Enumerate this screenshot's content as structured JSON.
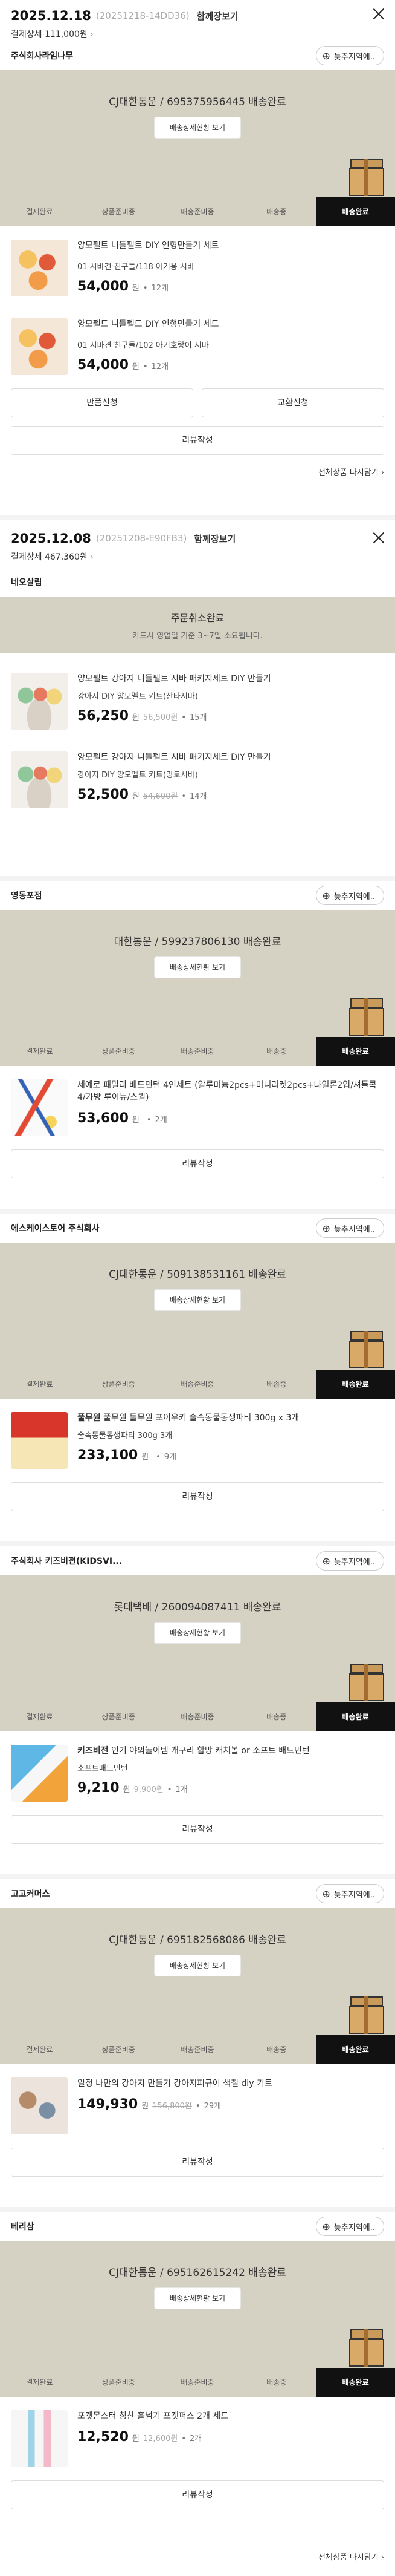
{
  "orders": [
    {
      "date": "2025.12.18",
      "order_no": "(20251218-14DD36)",
      "gift_label": "함께장보기",
      "pay_label": "결제상세",
      "pay_amount": "111,000원",
      "seller": "주식회사라임나무",
      "shipment": "CJ대한통운 / 695375956445 배송완료",
      "items": [
        {
          "name": "양모펠트 니들펠트 DIY 인형만들기 세트",
          "option": "01 시바견 친구들/118 아기용 시바",
          "price": "54,000",
          "qty": "12개"
        },
        {
          "name": "양모펠트 니들펠트 DIY 인형만들기 세트",
          "option": "01 시바견 친구들/102 아기호랑이 시바",
          "price": "54,000",
          "qty": "12개"
        }
      ],
      "return_label": "반품신청",
      "exchange_label": "교환신청",
      "review_label": "리뷰작성",
      "all_label": "전체상품 다시담기"
    },
    {
      "date": "2025.12.08",
      "order_no": "(20251208-E90FB3)",
      "gift_label": "함께장보기",
      "pay_label": "결제상세",
      "pay_amount": "467,360원",
      "seller": "네오살림",
      "cancel_title": "주문취소완료",
      "cancel_sub": "카드사 영업일 기준 3~7일 소요됩니다.",
      "items": [
        {
          "name": "양모펠트 강아지 니들펠트 시바 패키지세트 DIY 만들기",
          "option": "강아지 DIY 양모펠트 키트(산타시바)",
          "price": "56,250",
          "orig": "56,500원",
          "qty": "15개"
        },
        {
          "name": "양모펠트 강아지 니들펠트 시바 패키지세트 DIY 만들기",
          "option": "강아지 DIY 양모펠트 키트(망토시바)",
          "price": "52,500",
          "orig": "54,600원",
          "qty": "14개"
        }
      ]
    }
  ],
  "shipments": [
    {
      "seller": "영동포점",
      "status": "대한통운 / 599237806130 배송완료",
      "item_name": "세예로 패밀리 배드민턴 4인세트 (알루미늄2pcs+미니라켓2pcs+나일론2입/셔틀콕4/가방 루이뉴/스퀼)",
      "option": "",
      "price": "53,600",
      "orig": "",
      "qty": "2개",
      "seller_bold": ""
    },
    {
      "seller": "에스케이스토어 주식회사",
      "status": "CJ대한통운 / 509138531161 배송완료",
      "item_name": "풀무원 둘무원 포이우키 술속동물동생파티 300g x 3개",
      "option": "술속동물동생파티 300g 3개",
      "price": "233,100",
      "orig": "",
      "qty": "9개",
      "seller_bold": "풀무원"
    },
    {
      "seller": "주식회사 키즈비전(KIDSVI...",
      "status": "롯데택배 / 260094087411 배송완료",
      "item_name": "인기 야외놀이템 개구리 합방 캐치볼 or 소프트 배드민턴",
      "option": "소프트배드민턴",
      "price": "9,210",
      "orig": "9,900원",
      "qty": "1개",
      "seller_bold": "키즈비전"
    },
    {
      "seller": "고고커머스",
      "status": "CJ대한통운 / 695182568086 배송완료",
      "item_name": "일정 나만의 강아지 만들기 강아지피규어 색칠 diy 키트",
      "option": "",
      "price": "149,930",
      "orig": "156,800원",
      "qty": "29개",
      "seller_bold": ""
    },
    {
      "seller": "베리삼",
      "status": "CJ대한통운 / 695162615242 배송완료",
      "item_name": "포켓몬스터 칭찬 홀넘기 포켓퍼스 2개 세트",
      "option": "",
      "price": "12,520",
      "orig": "12,600원",
      "qty": "2개",
      "seller_bold": ""
    }
  ],
  "labels": {
    "news": "늦추지역에..",
    "detail_btn": "배송상세현황 보기",
    "won": "원",
    "review": "리뷰작성",
    "all_again": "전체상품 다시담기",
    "steps": [
      "결제완료",
      "상품준비중",
      "배송준비중",
      "배송중",
      "배송완료"
    ]
  }
}
